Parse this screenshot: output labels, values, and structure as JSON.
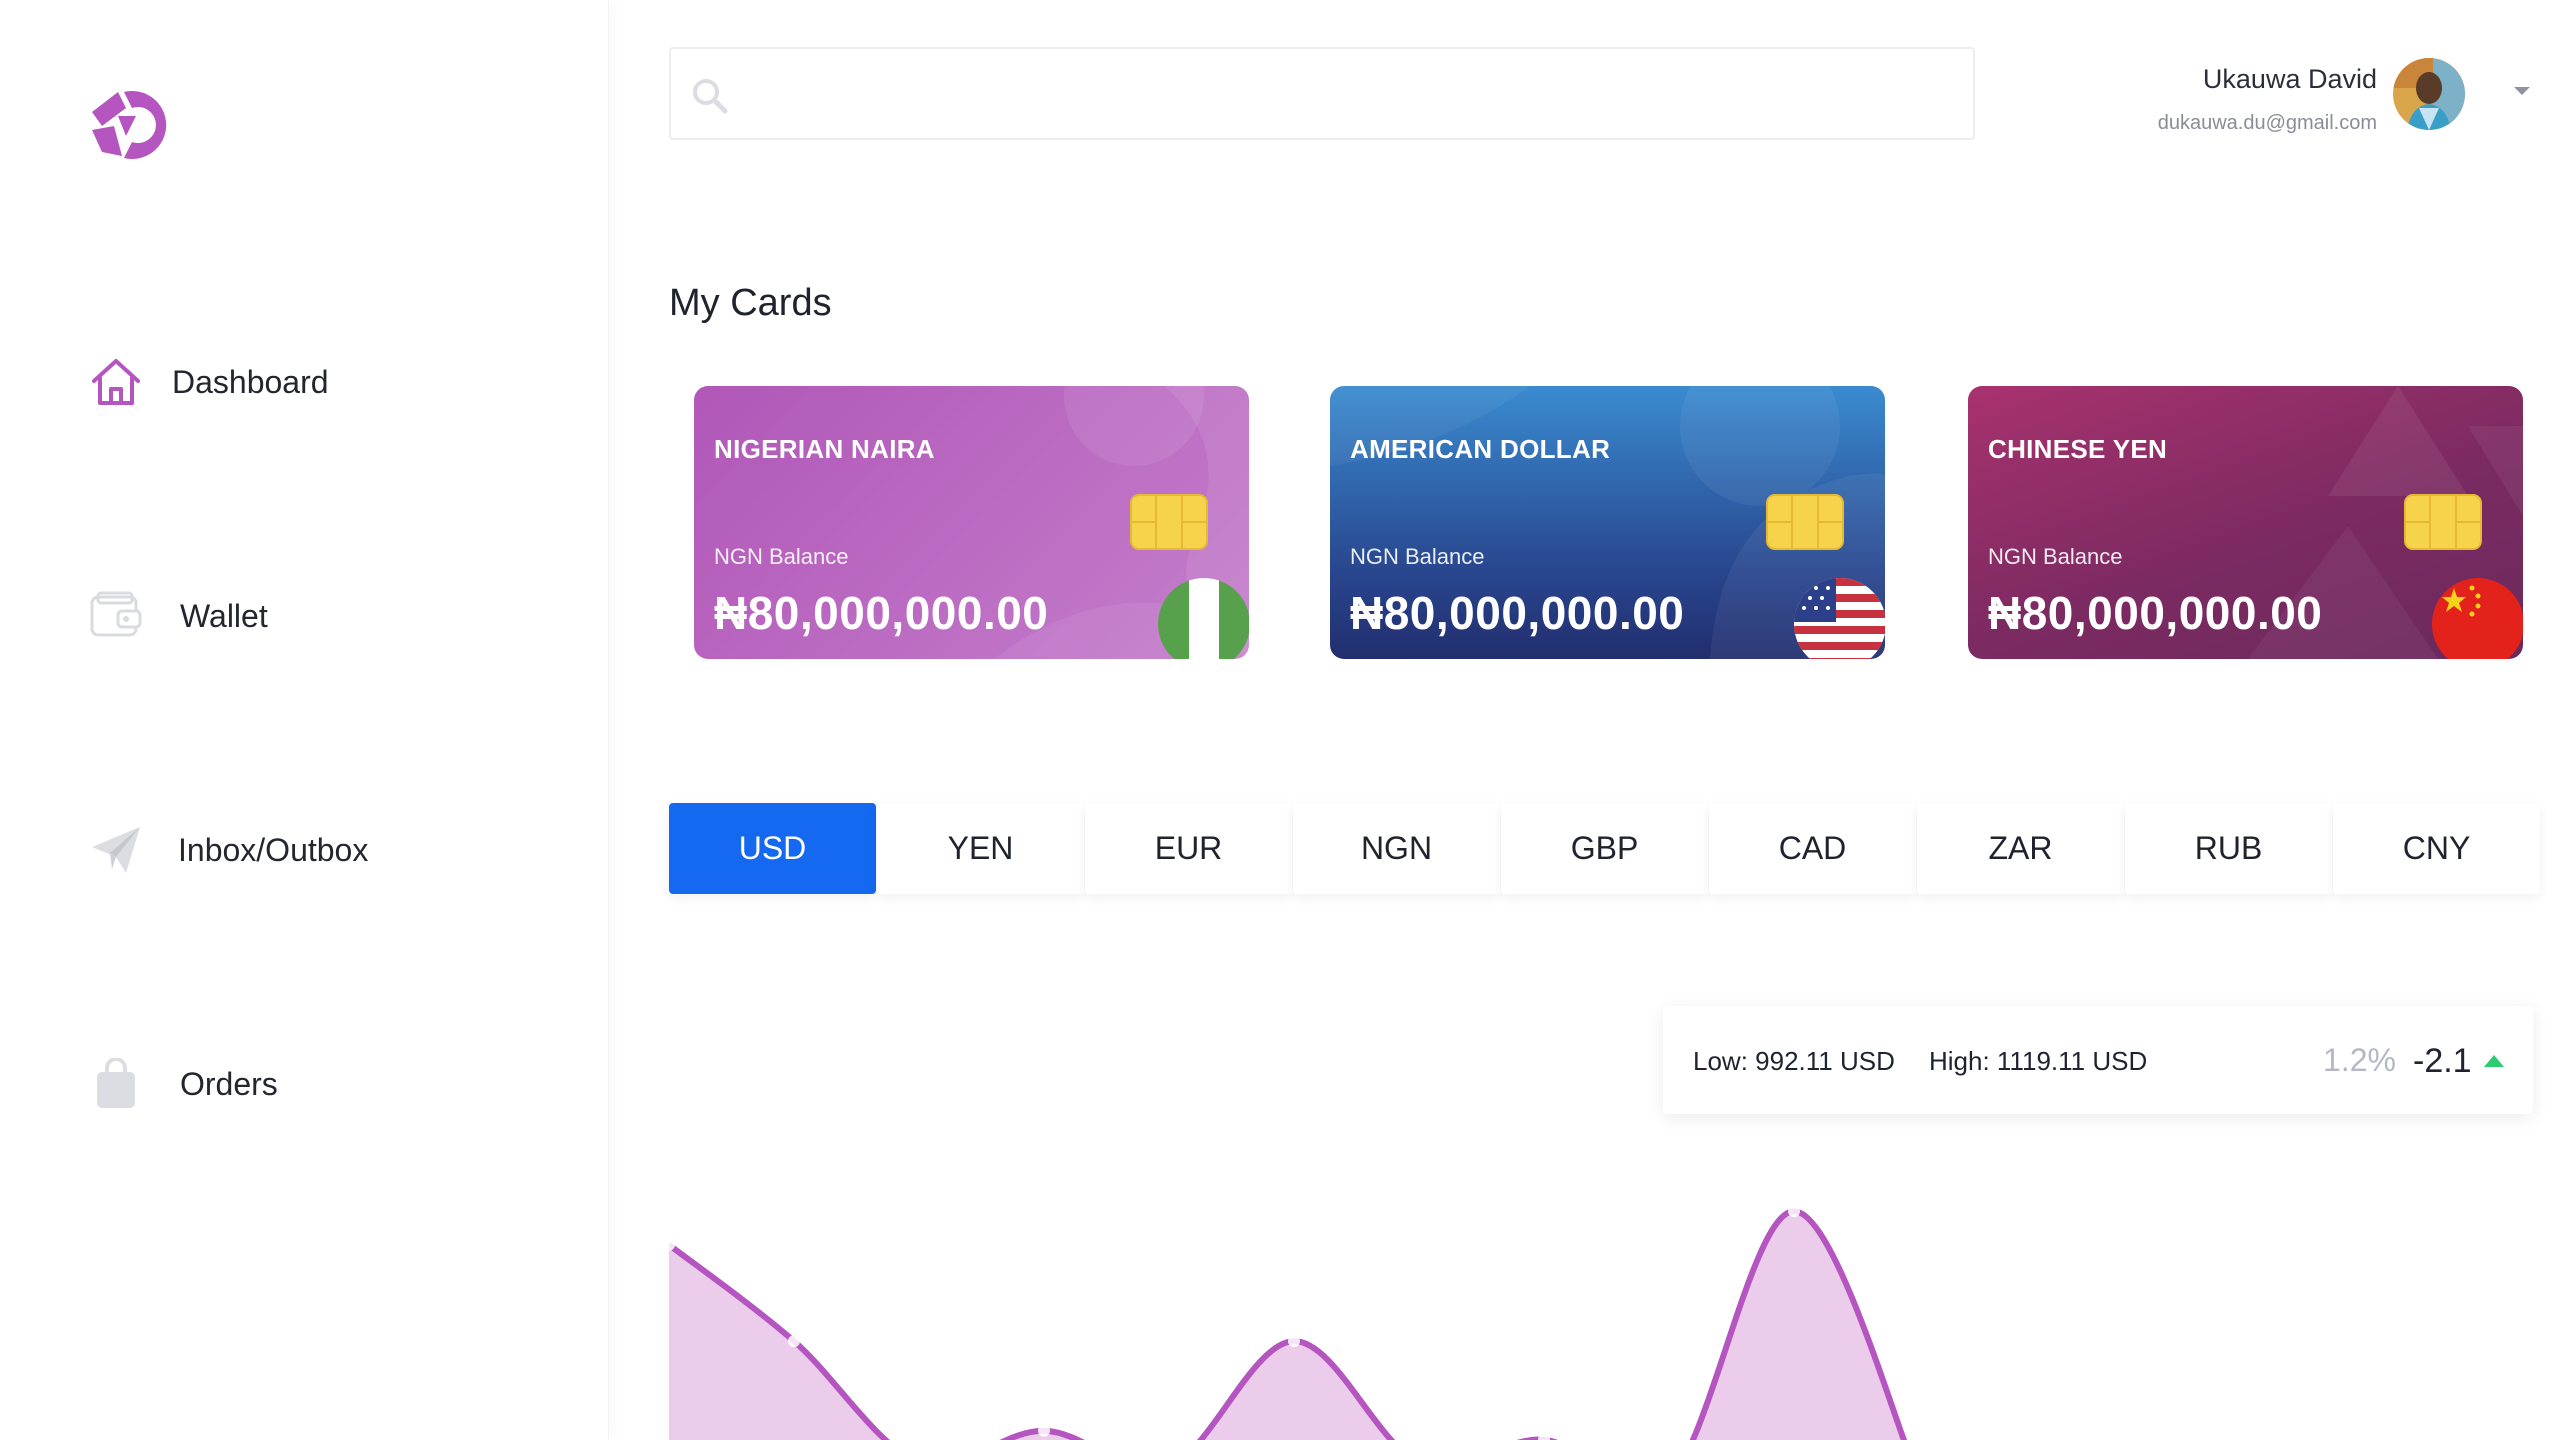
{
  "app": {
    "logo_icon": "brand-logo-icon",
    "brand_color": "#b555c0"
  },
  "sidebar": {
    "items": [
      {
        "label": "Dashboard",
        "icon": "home-icon"
      },
      {
        "label": "Wallet",
        "icon": "wallet-icon"
      },
      {
        "label": "Inbox/Outbox",
        "icon": "send-icon"
      },
      {
        "label": "Orders",
        "icon": "shopping-bag-icon"
      }
    ]
  },
  "header": {
    "search_placeholder": "",
    "search_value": "",
    "user_name": "Ukauwa David",
    "user_email": "dukauwa.du@gmail.com"
  },
  "cards": {
    "title": "My Cards",
    "items": [
      {
        "name": "NIGERIAN NAIRA",
        "balance_label": "NGN Balance",
        "balance": "₦80,000,000.00",
        "flag": "nigeria-flag-icon",
        "color": "#b560c0"
      },
      {
        "name": "AMERICAN DOLLAR",
        "balance_label": "NGN Balance",
        "balance": "₦80,000,000.00",
        "flag": "usa-flag-icon",
        "color": "#2d64a8"
      },
      {
        "name": "CHINESE YEN",
        "balance_label": "NGN Balance",
        "balance": "₦80,000,000.00",
        "flag": "china-flag-icon",
        "color": "#8a2c68"
      }
    ]
  },
  "currency_tabs": {
    "active": "USD",
    "items": [
      "USD",
      "YEN",
      "EUR",
      "NGN",
      "GBP",
      "CAD",
      "ZAR",
      "RUB",
      "CNY"
    ]
  },
  "stats": {
    "low": "Low: 992.11 USD",
    "high": "High: 1119.11 USD",
    "percent": "1.2%",
    "change": "-2.1",
    "trend_color": "#2ecc71"
  },
  "chart_data": {
    "type": "area",
    "title": "",
    "xlabel": "",
    "ylabel": "",
    "color": "#b555c0",
    "fill": "#ebcdeb",
    "x": [
      0,
      1,
      2,
      3,
      4,
      5,
      6,
      7,
      8,
      9,
      10
    ],
    "values": [
      105,
      62,
      8,
      22,
      6,
      62,
      8,
      18,
      0,
      120,
      0
    ],
    "ylim": [
      0,
      125
    ],
    "grid": false
  }
}
